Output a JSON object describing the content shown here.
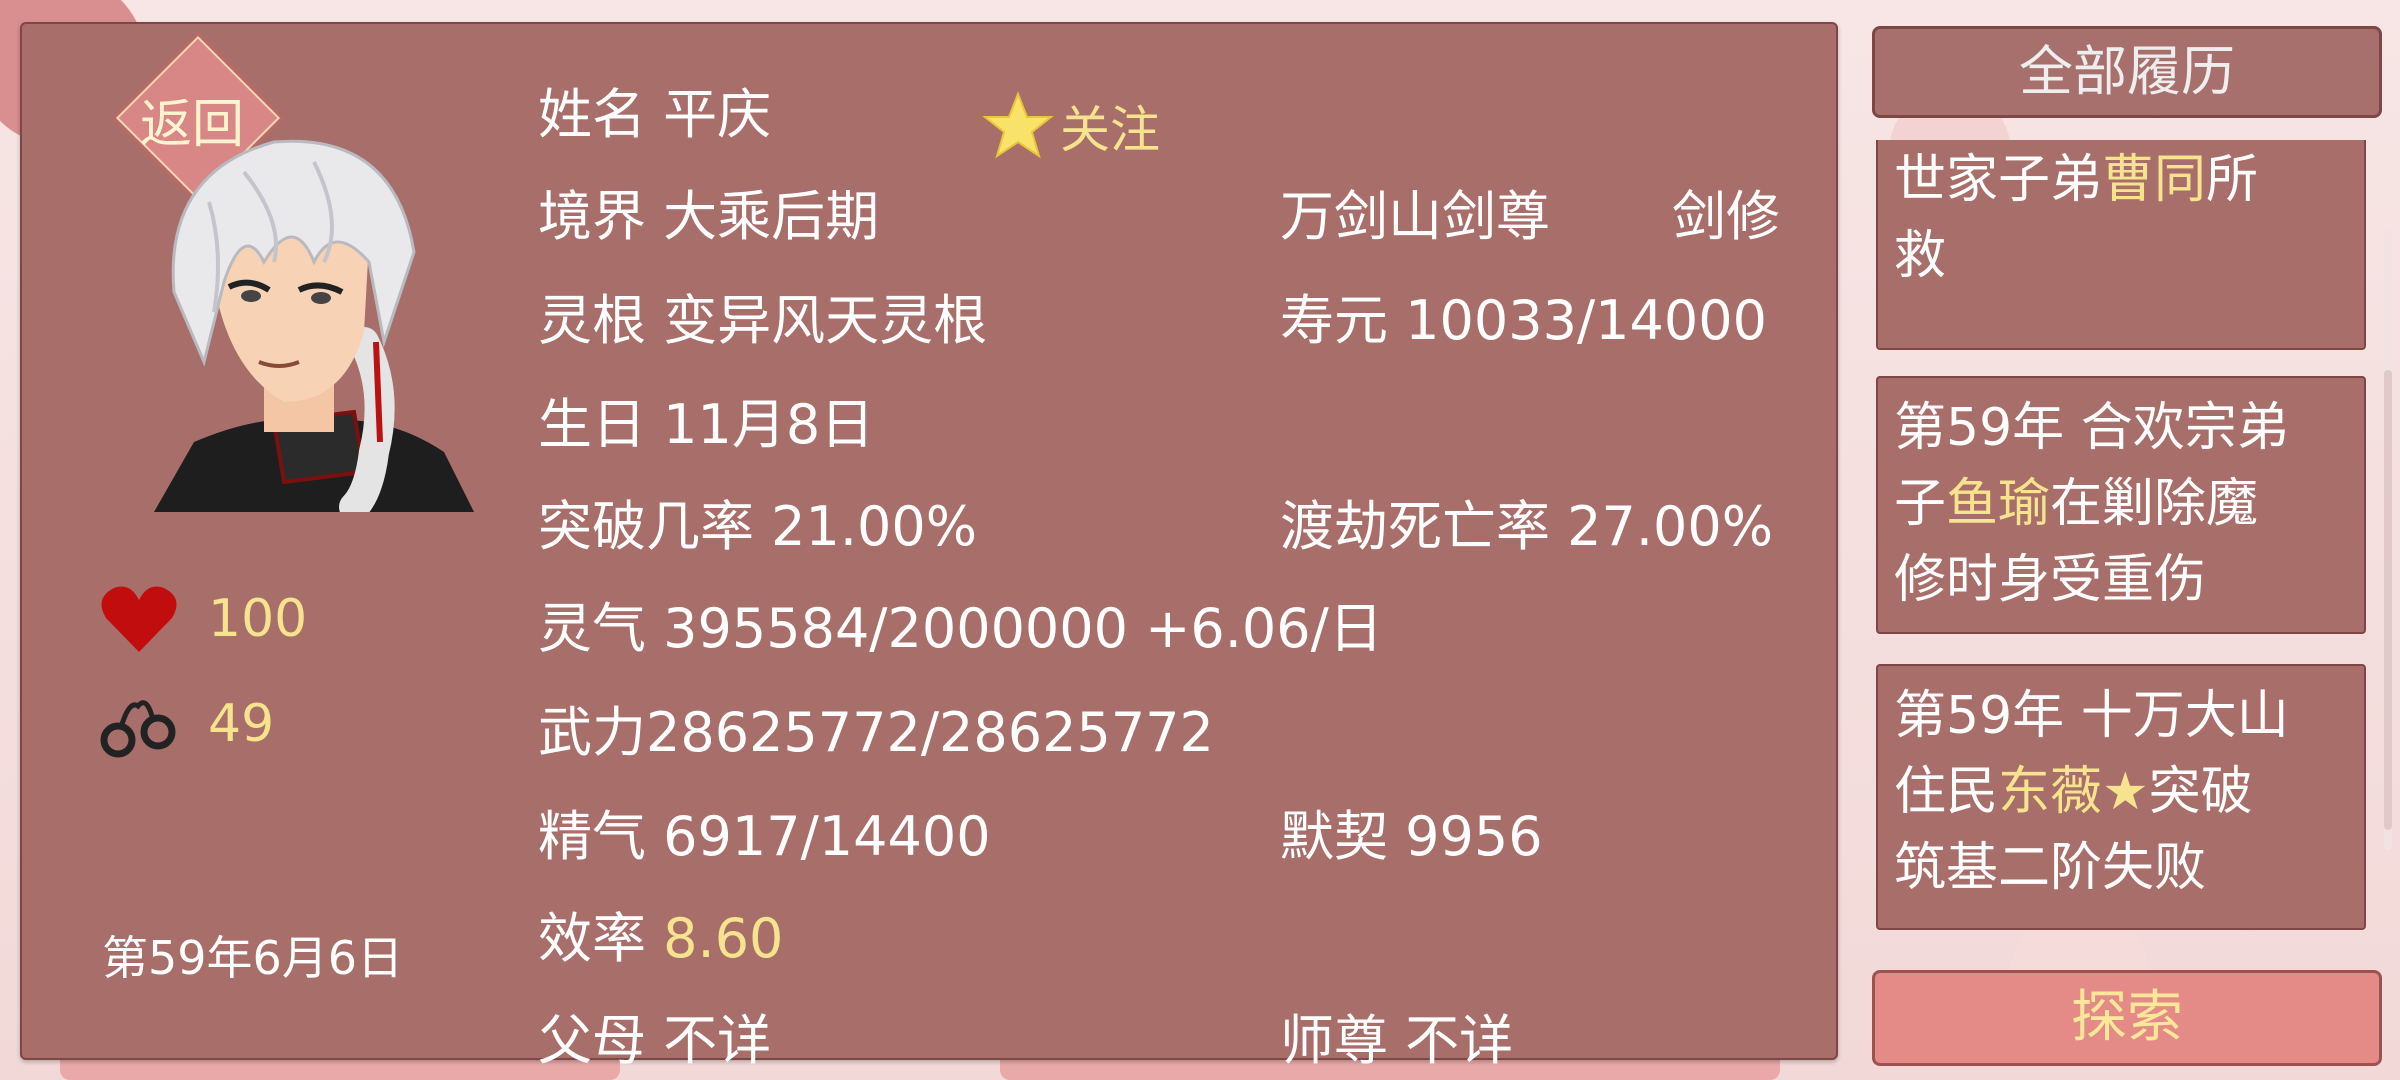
{
  "colors": {
    "panel": "#a86e6a",
    "highlight": "#f6e38e",
    "button_explore": "#e48b87"
  },
  "back_label": "返回",
  "follow_label": "关注",
  "stats": {
    "health": "100",
    "shackles": "49"
  },
  "date": "第59年6月6日",
  "info": {
    "name": "姓名 平庆",
    "realm": "境界 大乘后期",
    "sect_title": "万剑山剑尊",
    "profession": "剑修",
    "root": "灵根 变异风天灵根",
    "lifespan": "寿元 10033/14000",
    "birthday": "生日 11月8日",
    "breakthrough": "突破几率 21.00%",
    "tribulation_death": "渡劫死亡率 27.00%",
    "spirit_energy": "灵气 395584/2000000 +6.06/日",
    "force": "武力28625772/28625772",
    "vitality": "精气 6917/14400",
    "tacit": "默契 9956",
    "efficiency_label": "效率",
    "efficiency_value": "8.60",
    "parents": "父母 不详",
    "master": "师尊 不详"
  },
  "all_history_label": "全部履历",
  "history": [
    {
      "a": "",
      "lines_top": "世家子弟",
      "name": "曹同",
      "after": "所",
      "line3": "救"
    },
    {
      "l1": "第59年 合欢宗弟",
      "l2_pre": "子",
      "name": "鱼瑜",
      "l2_post": "在剿除魔",
      "l3": "修时身受重伤"
    },
    {
      "l1": "第59年 十万大山",
      "l2_pre": "住民",
      "name": "东薇★",
      "l2_post": "突破",
      "l3": "筑基二阶失败"
    }
  ],
  "explore_label": "探索"
}
